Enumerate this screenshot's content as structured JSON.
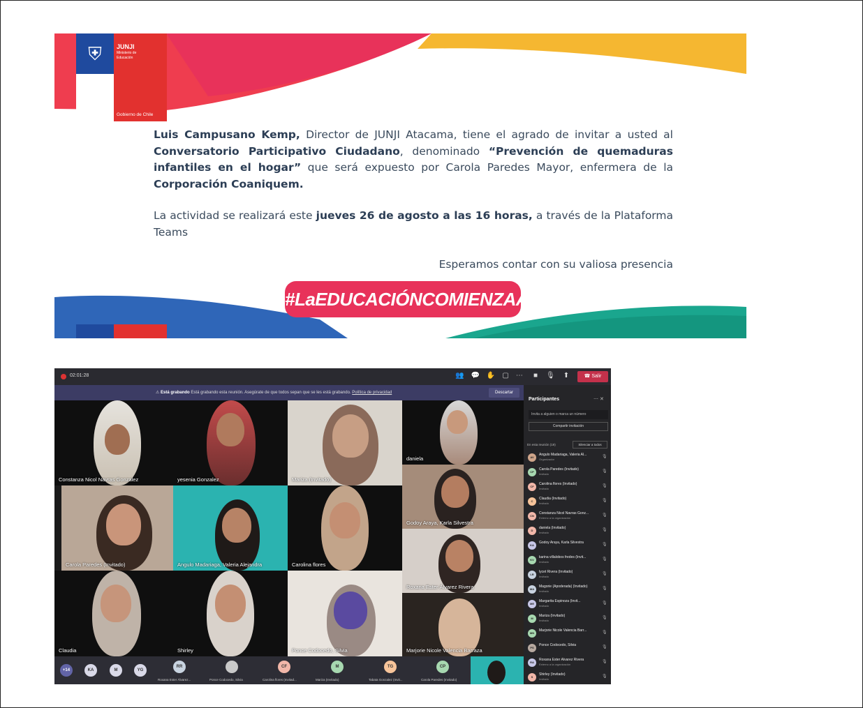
{
  "invitation": {
    "logo": {
      "title": "JUNJI",
      "subtitle": "Ministerio de Educación",
      "government": "Gobierno de Chile"
    },
    "paragraph1": {
      "director": "Luis Campusano Kemp,",
      "text1": " Director de JUNJI Atacama, tiene el agrado de invitar a usted al ",
      "event": "Conversatorio Participativo Ciudadano",
      "text2": ", denominado ",
      "topic": "“Prevención de quemaduras infantiles en el hogar”",
      "text3": " que será expuesto por Carola Paredes Mayor, enfermera de la ",
      "org": "Corporación Coaniquem."
    },
    "paragraph2": {
      "text1": "La actividad se realizará este ",
      "date": "jueves 26 de agosto a las 16 horas,",
      "text2": " a través de la Plataforma Teams"
    },
    "closing": "Esperamos contar con su valiosa presencia",
    "hashtag": "#LaEDUCACIÓNCOMIENZAAquí",
    "colors": {
      "red": "#e2312f",
      "blue": "#1f4a9e",
      "pink": "#e8325a",
      "yellow": "#f5b731",
      "teal": "#1aa68e"
    }
  },
  "teams": {
    "timer": "02:01:28",
    "recording_banner": {
      "bold": "Está grabando",
      "text": " Está grabando esta reunión. Asegúrate de que todos sepan que se les está grabando. ",
      "link": "Política de privacidad",
      "discard": "Descartar"
    },
    "leave_label": "Salir",
    "tiles": [
      {
        "name": "Constanza Nicol Navras Gonzalez"
      },
      {
        "name": "yesenia Gonzalez"
      },
      {
        "name": "Mariza (Invitado)"
      },
      {
        "name": "daniela"
      },
      {
        "name": "Carola Paredes (Invitado)"
      },
      {
        "name": "Angulo Madariaga, Valeria Alejandra"
      },
      {
        "name": "Carolina flores"
      },
      {
        "name": "Godoy Araya, Karla Silvestra"
      },
      {
        "name": "Roxana Ester  Álvarez Rivera"
      },
      {
        "name": "Claudia"
      },
      {
        "name": "Shirley"
      },
      {
        "name": "Ponce Codocedo, Silvia"
      },
      {
        "name": "Marjorie Nicole Valencia Barraza"
      }
    ],
    "bottom_bar": {
      "avatars": [
        {
          "initials": "+14",
          "color": "#6264a7"
        },
        {
          "initials": "KA",
          "color": "#d9d9e8"
        },
        {
          "initials": "M",
          "color": "#d9d9e8"
        },
        {
          "initials": "YG",
          "color": "#d9d9e8"
        },
        {
          "initials": "RR",
          "color": "#c8d3e0"
        },
        {
          "initials": "",
          "color": "#c9c9c9"
        },
        {
          "initials": "CF",
          "color": "#f2b7a9"
        },
        {
          "initials": "M",
          "color": "#a7d8b0"
        },
        {
          "initials": "TG",
          "color": "#f7c49a"
        },
        {
          "initials": "CP",
          "color": "#a7d8b0"
        }
      ],
      "captions": [
        "Roxana Ester Álvarez...",
        "Ponce Codocedo, Silvia",
        "Carolina flores (Invitad...",
        "Mariza (Invitado)",
        "Tabata Gonzalez (Invit...",
        "Carola Paredes (Invitado)"
      ]
    },
    "panel": {
      "title": "Participantes",
      "search_placeholder": "Invita a alguien o marca un número",
      "share": "Compartir invitación",
      "section": "En esta reunión (19)",
      "mute_all": "Silenciar a todos",
      "participants": [
        {
          "name": "Angulo Madariaga, Valeria Al...",
          "role": "Organizador",
          "initials": "AV",
          "color": "#cfa58a"
        },
        {
          "name": "Carola Paredes (Invitado)",
          "role": "Invitado",
          "initials": "CP",
          "color": "#a7d8b0"
        },
        {
          "name": "Carolina flores (Invitado)",
          "role": "Invitado",
          "initials": "CF",
          "color": "#f2b7a9"
        },
        {
          "name": "Claudia (Invitado)",
          "role": "Invitado",
          "initials": "C",
          "color": "#f7c49a"
        },
        {
          "name": "Constanza Nicol Navras Gonz...",
          "role": "Externo a la organización",
          "initials": "CN",
          "color": "#f2b7a9"
        },
        {
          "name": "daniela (Invitado)",
          "role": "Invitado",
          "initials": "D",
          "color": "#f2b7a9"
        },
        {
          "name": "Godoy Araya, Karla Silvestra",
          "role": "",
          "initials": "KA",
          "color": "#c8c8e8"
        },
        {
          "name": "karina villalobos fredes (Invit...",
          "role": "Invitado",
          "initials": "KV",
          "color": "#a7d8b0"
        },
        {
          "name": "lycet Rivera (Invitado)",
          "role": "Invitado",
          "initials": "LR",
          "color": "#c8d3e0"
        },
        {
          "name": "Magorie (Apoderada) (Invitado)",
          "role": "Invitado",
          "initials": "MA",
          "color": "#c8d3e0"
        },
        {
          "name": "Margarita Espinoza (Invit...",
          "role": "Invitado",
          "initials": "ME",
          "color": "#c8c8e8"
        },
        {
          "name": "Mariza (Invitado)",
          "role": "Invitado",
          "initials": "M",
          "color": "#a7d8b0"
        },
        {
          "name": "Marjorie Nicole Valencia Barr...",
          "role": "",
          "initials": "MN",
          "color": "#a7d8b0"
        },
        {
          "name": "Ponce Codocedo, Silvia",
          "role": "",
          "initials": "PS",
          "color": "#b7a9a0"
        },
        {
          "name": "Roxana Ester Álvarez Rivera",
          "role": "Externo a la organización",
          "initials": "RA",
          "color": "#c8c8e8"
        },
        {
          "name": "Shirley (Invitado)",
          "role": "Invitado",
          "initials": "S",
          "color": "#f2b7a9"
        }
      ]
    }
  }
}
